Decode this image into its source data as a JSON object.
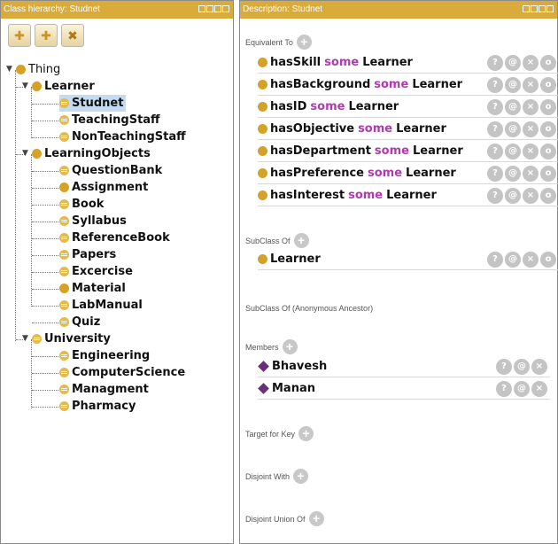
{
  "left_panel": {
    "title": "Class hierarchy: Studnet",
    "toolbar": [
      {
        "icon": "add-subclass-icon",
        "glyph": "✚"
      },
      {
        "icon": "add-sibling-icon",
        "glyph": "✚"
      },
      {
        "icon": "delete-class-icon",
        "glyph": "✖"
      }
    ],
    "tree": {
      "thing": "Thing",
      "learner": "Learner",
      "studnet": "Studnet",
      "teaching_staff": "TeachingStaff",
      "non_teaching_staff": "NonTeachingStaff",
      "learning_objects": "LearningObjects",
      "question_bank": "QuestionBank",
      "assignment": "Assignment",
      "book": "Book",
      "syllabus": "Syllabus",
      "reference_book": "ReferenceBook",
      "papers": "Papers",
      "excercise": "Excercise",
      "material": "Material",
      "lab_manual": "LabManual",
      "quiz": "Quiz",
      "university": "University",
      "engineering": "Engineering",
      "computer_science": "ComputerScience",
      "managment": "Managment",
      "pharmacy": "Pharmacy"
    }
  },
  "right_panel": {
    "title": "Description: Studnet",
    "sections": {
      "equivalent_to": "Equivalent To",
      "subclass_of": "SubClass Of",
      "subclass_anon": "SubClass Of (Anonymous Ancestor)",
      "members": "Members",
      "target_for_key": "Target for Key",
      "disjoint_with": "Disjoint With",
      "disjoint_union_of": "Disjoint Union Of"
    },
    "keyword": "some",
    "equivalents": [
      {
        "property": "hasSkill",
        "filler": "Learner"
      },
      {
        "property": "hasBackground",
        "filler": "Learner"
      },
      {
        "property": "hasID",
        "filler": "Learner"
      },
      {
        "property": "hasObjective",
        "filler": "Learner"
      },
      {
        "property": "hasDepartment",
        "filler": "Learner"
      },
      {
        "property": "hasPreference",
        "filler": "Learner"
      },
      {
        "property": "hasInterest",
        "filler": "Learner"
      }
    ],
    "superclass": "Learner",
    "members": [
      "Bhavesh",
      "Manan"
    ],
    "action_glyphs": {
      "explain": "?",
      "annotate": "@",
      "delete": "×",
      "edit": "o"
    },
    "plus_glyph": "+"
  },
  "colors": {
    "title_bar": "#d9ab3a",
    "class_dot": "#d4a227",
    "keyword": "#b03ab0",
    "individual": "#6a2f7a",
    "selection": "#c5dcf0"
  }
}
